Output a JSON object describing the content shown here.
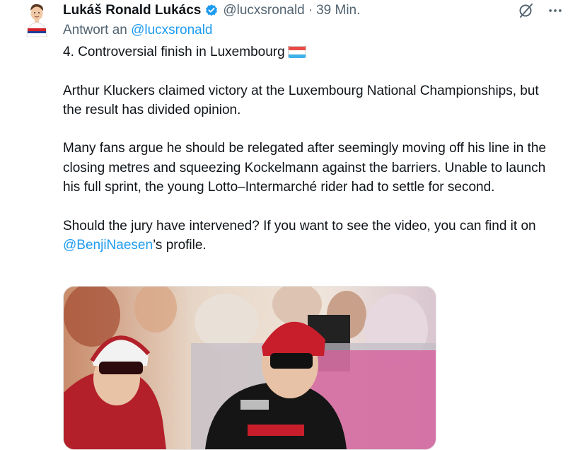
{
  "author": {
    "name": "Lukáš Ronald Lukács",
    "handle": "@lucxsronald",
    "separator": "·",
    "time": "39 Min."
  },
  "reply": {
    "prefix": "Antwort an",
    "handle": "@lucxsronald"
  },
  "tweet": {
    "line1": "4. Controversial finish in Luxembourg",
    "para2": "Arthur Kluckers claimed victory at the Luxembourg National Championships, but the result has divided opinion.",
    "para3": "Many fans argue he should be relegated after seemingly moving off his line in the closing metres and squeezing Kockelmann against the barriers. Unable to launch his full sprint, the young Lotto–Intermarché rider had to settle for second.",
    "para4_before": "Should the jury have intervened? If you want to see the video, you can find it on ",
    "para4_mention": "@BenjiNaesen",
    "para4_after": "’s profile."
  },
  "icons": {
    "verified": "verified-badge-icon",
    "grok": "grok-icon",
    "more": "more-options-icon",
    "flag": "luxembourg-flag-icon"
  },
  "colors": {
    "link": "#1d9bf0",
    "secondary_text": "#536471",
    "primary_text": "#0f1419"
  }
}
